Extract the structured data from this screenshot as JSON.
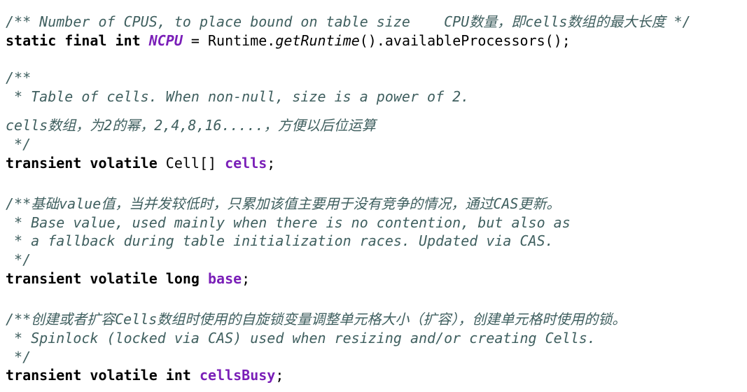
{
  "code": {
    "ncpu_comment": "/** Number of CPUS, to place bound on table size    CPU数量，即cells数组的最大长度 */",
    "ncpu_decl": {
      "modifiers": "static final int ",
      "name": "NCPU",
      "eq": " = Runtime.",
      "method": "getRuntime",
      "rest": "().availableProcessors();"
    },
    "cells_comment_open": "/**",
    "cells_comment_line1": " * Table of cells. When non-null, size is a power of 2.",
    "cells_comment_line2": "cells数组，为2的幂，2,4,8,16.....，方便以后位运算",
    "cells_comment_close": " */",
    "cells_decl": {
      "modifiers": "transient volatile ",
      "type": "Cell[] ",
      "name": "cells",
      "end": ";"
    },
    "base_comment_line1": "/**基础value值，当并发较低时，只累加该值主要用于没有竞争的情况，通过CAS更新。",
    "base_comment_line2": " * Base value, used mainly when there is no contention, but also as",
    "base_comment_line3": " * a fallback during table initialization races. Updated via CAS.",
    "base_comment_close": " */",
    "base_decl": {
      "modifiers": "transient volatile long ",
      "name": "base",
      "end": ";"
    },
    "busy_comment_line1": "/**创建或者扩容Cells数组时使用的自旋锁变量调整单元格大小（扩容），创建单元格时使用的锁。",
    "busy_comment_line2": " * Spinlock (locked via CAS) used when resizing and/or creating Cells.",
    "busy_comment_close": " */",
    "busy_decl": {
      "modifiers": "transient volatile int ",
      "name": "cellsBusy",
      "end": ";"
    }
  },
  "colors": {
    "comment": "#3f5f5f",
    "keyword": "#000000",
    "field": "#7a1fb8",
    "background": "#ffffff"
  }
}
